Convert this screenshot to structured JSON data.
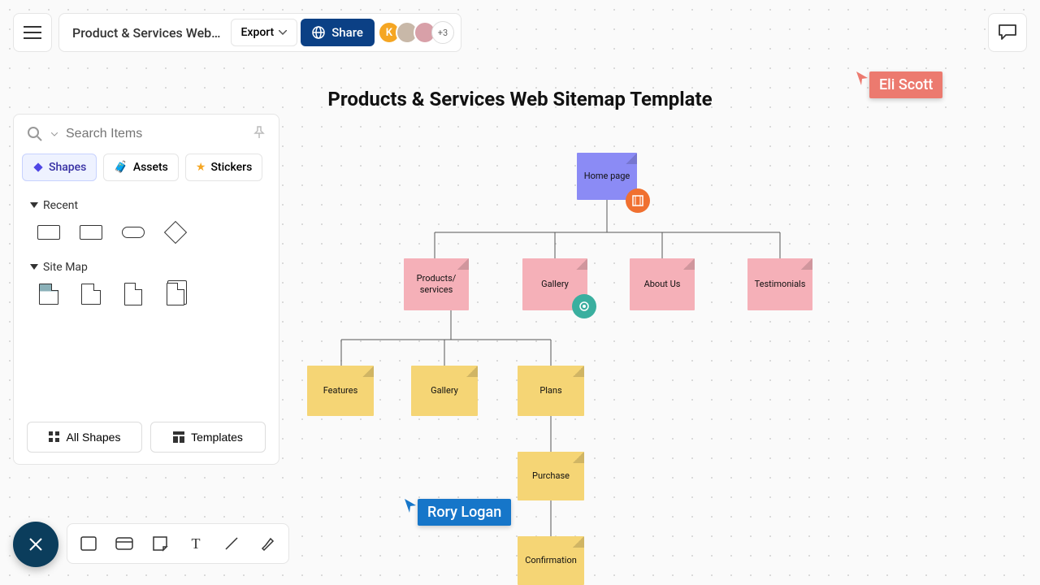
{
  "doc_title": "Product & Services Web…",
  "export_label": "Export",
  "share_label": "Share",
  "avatar_initial": "K",
  "avatar_more": "+3",
  "search_placeholder": "Search Items",
  "tabs": {
    "shapes": "Shapes",
    "assets": "Assets",
    "stickers": "Stickers"
  },
  "sections": {
    "recent": "Recent",
    "sitemap": "Site Map"
  },
  "footer": {
    "all_shapes": "All Shapes",
    "templates": "Templates"
  },
  "canvas_title": "Products & Services Web Sitemap Template",
  "nodes": {
    "home": "Home page",
    "products": "Products/\nservices",
    "gallery1": "Gallery",
    "about": "About Us",
    "testimonials": "Testimonials",
    "features": "Features",
    "gallery2": "Gallery",
    "plans": "Plans",
    "purchase": "Purchase",
    "confirmation": "Confirmation"
  },
  "cursors": {
    "eli": "Eli Scott",
    "rory": "Rory Logan"
  },
  "colors": {
    "share": "#0b4085",
    "home": "#8b8bf5",
    "pink": "#f5b0b8",
    "yellow": "#f5d575",
    "eli": "#ec7a6f",
    "rory": "#1676c9"
  }
}
